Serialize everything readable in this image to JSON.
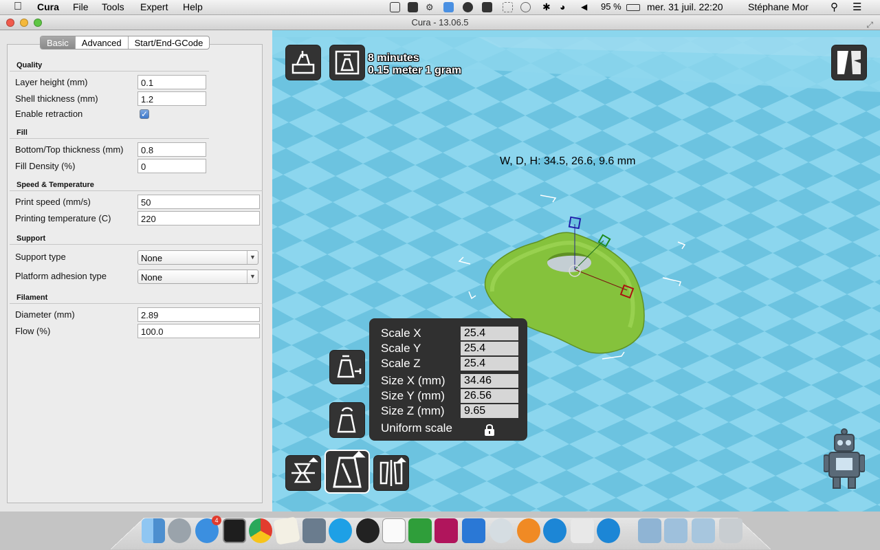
{
  "menubar": {
    "app_name": "Cura",
    "menus": [
      "File",
      "Tools",
      "Expert",
      "Help"
    ],
    "battery": "95 %",
    "datetime": "mer. 31 juil.  22:20",
    "user": "Stéphane Mor"
  },
  "window": {
    "title": "Cura - 13.06.5"
  },
  "tabs": [
    "Basic",
    "Advanced",
    "Start/End-GCode"
  ],
  "active_tab": "Basic",
  "settings": {
    "quality": {
      "title": "Quality",
      "layer_height_label": "Layer height (mm)",
      "layer_height": "0.1",
      "shell_thickness_label": "Shell thickness (mm)",
      "shell_thickness": "1.2",
      "retraction_label": "Enable retraction",
      "retraction_checked": "✓"
    },
    "fill": {
      "title": "Fill",
      "bottom_top_label": "Bottom/Top thickness (mm)",
      "bottom_top": "0.8",
      "density_label": "Fill Density (%)",
      "density": "0"
    },
    "speed": {
      "title": "Speed & Temperature",
      "print_speed_label": "Print speed (mm/s)",
      "print_speed": "50",
      "temp_label": "Printing temperature (C)",
      "temp": "220"
    },
    "support": {
      "title": "Support",
      "type_label": "Support type",
      "type": "None",
      "adhesion_label": "Platform adhesion type",
      "adhesion": "None"
    },
    "filament": {
      "title": "Filament",
      "diameter_label": "Diameter (mm)",
      "diameter": "2.89",
      "flow_label": "Flow (%)",
      "flow": "100.0"
    }
  },
  "viewport": {
    "print_time": "8 minutes",
    "print_material": "0.15 meter 1 gram",
    "dimensions": "W, D, H: 34.5, 26.6, 9.6 mm",
    "bed_color": "#7fd0e9",
    "model_color": "#8bc73f"
  },
  "scale_panel": {
    "scale_x_label": "Scale X",
    "scale_x": "25.4",
    "scale_y_label": "Scale Y",
    "scale_y": "25.4",
    "scale_z_label": "Scale Z",
    "scale_z": "25.4",
    "size_x_label": "Size X (mm)",
    "size_x": "34.46",
    "size_y_label": "Size Y (mm)",
    "size_y": "26.56",
    "size_z_label": "Size Z (mm)",
    "size_z": "9.65",
    "uniform_label": "Uniform scale"
  },
  "dock": {
    "icons": [
      "finder-icon",
      "launchpad-icon",
      "app-store-icon",
      "terminal-icon",
      "chrome-icon",
      "textedit-icon",
      "mail-icon",
      "skype-icon",
      "camera-icon",
      "document-icon",
      "excel-icon",
      "indesign-icon",
      "word-icon",
      "eye-icon",
      "blender-icon",
      "cura-icon",
      "bird-icon",
      "cura-icon-2",
      "applications-folder-icon",
      "documents-folder-icon",
      "downloads-folder-icon",
      "trash-icon"
    ],
    "app_store_badge": "4"
  }
}
